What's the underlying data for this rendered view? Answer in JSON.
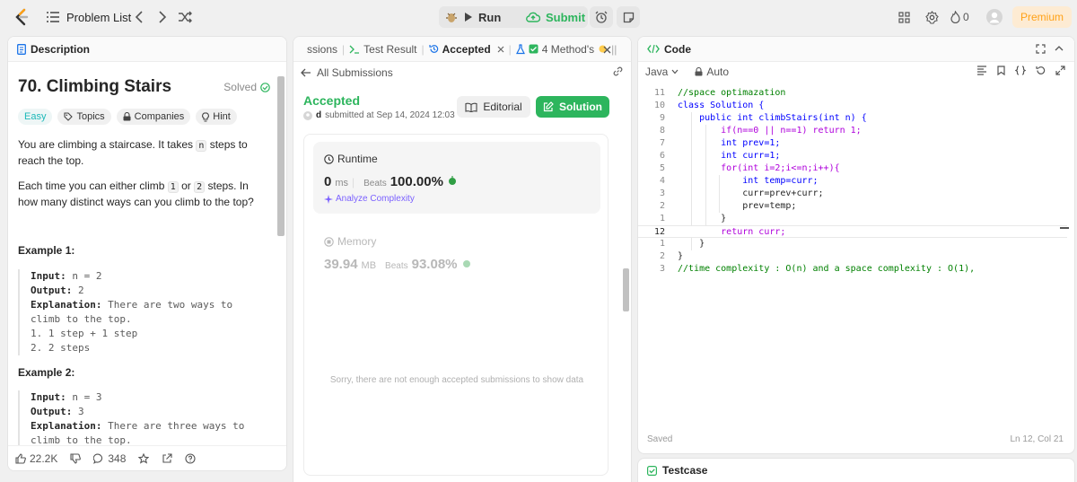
{
  "topbar": {
    "problem_list": "Problem List",
    "run": "Run",
    "submit": "Submit",
    "streak_count": "0",
    "premium": "Premium"
  },
  "description": {
    "tab_label": "Description",
    "title": "70. Climbing Stairs",
    "solved": "Solved",
    "tags": {
      "easy": "Easy",
      "topics": "Topics",
      "companies": "Companies",
      "hint": "Hint"
    },
    "para1_a": "You are climbing a staircase. It takes ",
    "para1_code": "n",
    "para1_b": " steps to reach the top.",
    "para2_a": "Each time you can either climb ",
    "para2_code1": "1",
    "para2_or": " or ",
    "para2_code2": "2",
    "para2_b": " steps. In how many distinct ways can you climb to the top?",
    "example1": {
      "heading": "Example 1:",
      "input_label": "Input:",
      "input_value": " n = 2",
      "output_label": "Output:",
      "output_value": " 2",
      "explanation_label": "Explanation:",
      "explanation_value": " There are two ways to climb to the top.",
      "line1": "1. 1 step + 1 step",
      "line2": "2. 2 steps"
    },
    "example2": {
      "heading": "Example 2:",
      "input_label": "Input:",
      "input_value": " n = 3",
      "output_label": "Output:",
      "output_value": " 3",
      "explanation_label": "Explanation:",
      "explanation_value": " There are three ways to climb to the top."
    },
    "footer": {
      "likes": "22.2K",
      "comments": "348"
    }
  },
  "submission": {
    "tabs": {
      "submissions": "ssions",
      "test_result": "Test Result",
      "accepted": "Accepted",
      "method": "4 Method's"
    },
    "all_submissions": "All Submissions",
    "status": "Accepted",
    "user": "d",
    "submitted_at": "submitted at Sep 14, 2024 12:03",
    "editorial": "Editorial",
    "solution": "Solution",
    "runtime": {
      "title": "Runtime",
      "value": "0",
      "unit": "ms",
      "beats_label": "Beats",
      "beats_value": "100.00%",
      "analyze": "Analyze Complexity"
    },
    "memory": {
      "title": "Memory",
      "value": "39.94",
      "unit": "MB",
      "beats_label": "Beats",
      "beats_value": "93.08%"
    },
    "sorry": "Sorry, there are not enough accepted submissions to show data"
  },
  "code": {
    "tab_label": "Code",
    "language": "Java",
    "mode": "Auto",
    "lines": [
      {
        "num": "11",
        "text": "//space optimazation"
      },
      {
        "num": "10",
        "text": "class Solution {"
      },
      {
        "num": "9",
        "text": "    public int climbStairs(int n) {"
      },
      {
        "num": "8",
        "text": "        if(n==0 || n==1) return 1;"
      },
      {
        "num": "7",
        "text": "        int prev=1;"
      },
      {
        "num": "6",
        "text": "        int curr=1;"
      },
      {
        "num": "5",
        "text": "        for(int i=2;i<=n;i++){"
      },
      {
        "num": "4",
        "text": "            int temp=curr;"
      },
      {
        "num": "3",
        "text": "            curr=prev+curr;"
      },
      {
        "num": "2",
        "text": "            prev=temp;"
      },
      {
        "num": "1",
        "text": "        }"
      },
      {
        "num": "12",
        "text": "        return curr;"
      },
      {
        "num": "1",
        "text": "    }"
      },
      {
        "num": "2",
        "text": "}"
      },
      {
        "num": "3",
        "text": "//time complexity : O(n) and a space complexity : O(1),"
      }
    ],
    "saved": "Saved",
    "cursor": "Ln 12, Col 21"
  },
  "testcase": {
    "label": "Testcase"
  },
  "colors": {
    "accent_green": "#2db55d",
    "premium_orange": "#ffa116",
    "easy_teal": "#1cb8b8",
    "analyze_purple": "#7b61ff"
  }
}
